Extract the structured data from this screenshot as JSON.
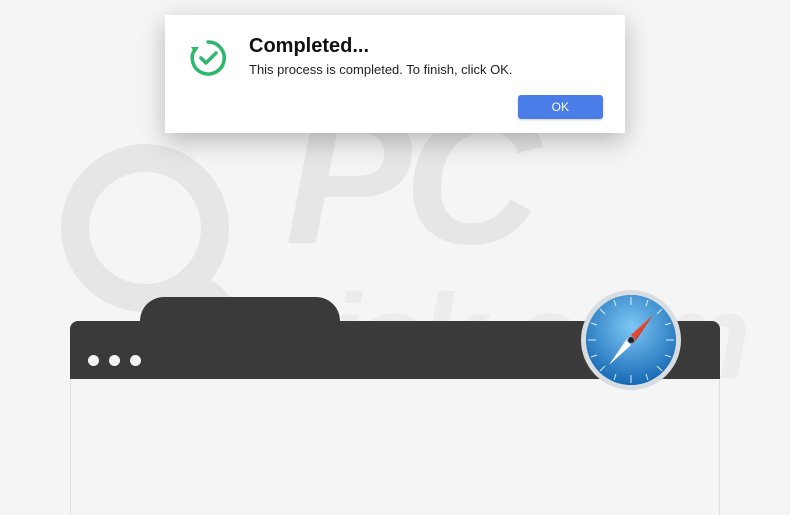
{
  "dialog": {
    "title": "Completed...",
    "message": "This process is completed. To finish, click OK.",
    "ok_label": "OK"
  },
  "watermark": {
    "line1": "PC",
    "line2": "risk.com"
  },
  "icons": {
    "dialog_icon": "checkmark-refresh-icon",
    "app_icon": "safari-icon"
  },
  "colors": {
    "dialog_button": "#4a7de8",
    "dialog_icon": "#2eb86b",
    "safari_blue": "#2a89d6",
    "titlebar": "#3a3a3a"
  }
}
